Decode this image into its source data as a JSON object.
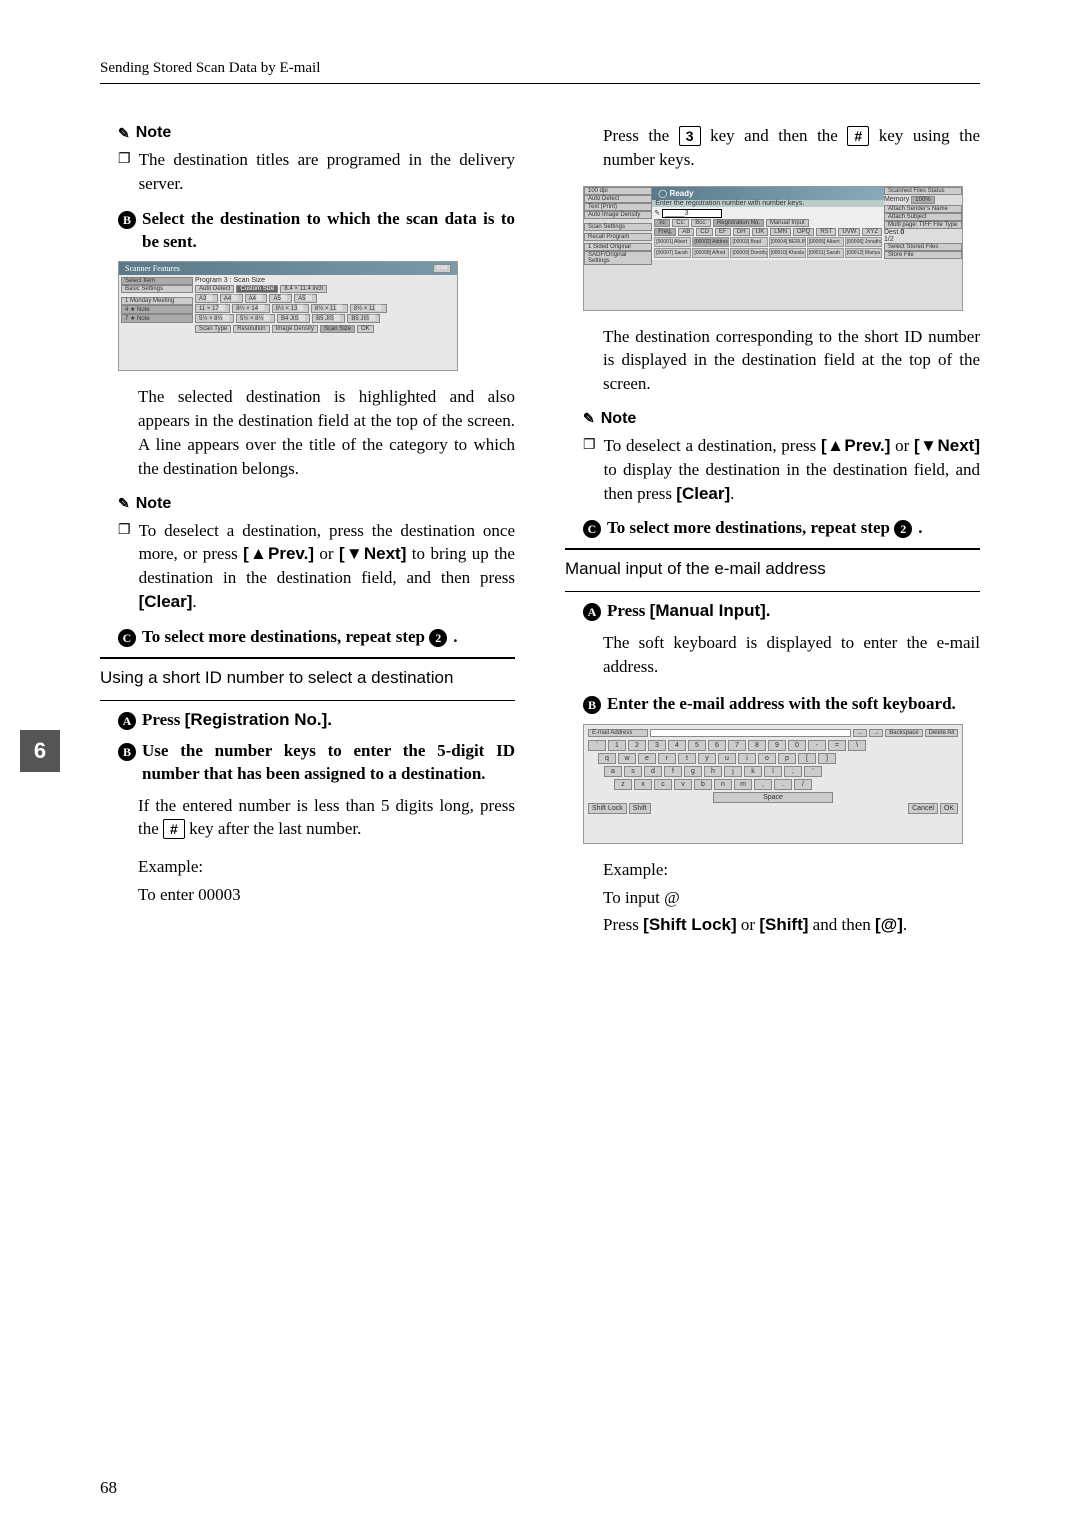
{
  "header": {
    "section_title": "Sending Stored Scan Data by E-mail"
  },
  "page_number": "68",
  "side_tab": "6",
  "left": {
    "note1": {
      "label": "Note",
      "bullet": "The destination titles are programed in the delivery server."
    },
    "step2": "Select the destination to which the scan data is to be sent.",
    "body1": "The selected destination is highlighted and also appears in the destination field at the top of the screen. A line appears over the title of the category to which the destination belongs.",
    "note2": {
      "label": "Note",
      "bullet_pre": "To deselect a destination, press the destination once more, or press ",
      "prev": "[▲Prev.]",
      "mid": " or ",
      "next": "[▼Next]",
      "bullet_post": " to bring up the destination in the destination field, and then press ",
      "clear": "[Clear]",
      "end": "."
    },
    "step3": {
      "pre": "To select more destinations, repeat step ",
      "refnum": "2",
      "post": "."
    },
    "subhead1": "Using a short ID number to select a destination",
    "stepA1": {
      "pre": "Press ",
      "btn": "[Registration No.].",
      "post": ""
    },
    "stepA2": {
      "line": "Use the number keys to enter the 5-digit ID number that has been assigned to a destination.",
      "body_pre": "If the entered number is less than 5 digits long, press the ",
      "key": "#",
      "body_post": " key after the last number."
    },
    "example": "Example:",
    "example_line": "To enter 00003"
  },
  "right": {
    "intro": {
      "pre": "Press the ",
      "key3": "3",
      "mid": " key and then the ",
      "keyhash": "#",
      "post": " key using the number keys."
    },
    "body1": "The destination corresponding to the short ID number is displayed in the destination field at the top of the screen.",
    "note": {
      "label": "Note",
      "bullet_pre": "To deselect a destination, press ",
      "prev": "[▲Prev.]",
      "mid": " or ",
      "next": "[▼Next]",
      "bullet_post": " to display the destination in the destination field, and then press ",
      "clear": "[Clear]",
      "end": "."
    },
    "step3": {
      "pre": "To select more destinations, repeat step ",
      "refnum": "2",
      "post": "."
    },
    "subhead": "Manual input of the e-mail address",
    "mstep1": {
      "pre": "Press ",
      "btn": "[Manual Input].",
      "post": ""
    },
    "mbody1": "The soft keyboard is displayed to enter the e-mail address.",
    "mstep2": "Enter the e-mail address with the soft keyboard.",
    "example": "Example:",
    "example_line": "To input @",
    "example2_pre": "Press ",
    "example2_a": "[Shift Lock]",
    "example2_mid": " or ",
    "example2_b": "[Shift]",
    "example2_mid2": " and then ",
    "example2_c": "[@]",
    "example2_end": "."
  },
  "screenshot1": {
    "title": "Scanner Features",
    "exit": "Exit",
    "tabs": [
      "Select Item",
      "Basic Settings"
    ],
    "subtitle": "Program 3 : Scan Size",
    "auto_detect": "Auto Detect",
    "custom_size": "Custom Size",
    "custom_val": "8.4 × 11.4 inch",
    "sizes_row1": [
      "A3⬜",
      "A4⬜",
      "A4⬜",
      "A5⬜",
      "A5⬜"
    ],
    "sizes_row2": [
      "11 × 17⬜",
      "8½ × 14⬜",
      "8½ × 13⬜",
      "8½ × 11⬜",
      "8½ × 11⬜"
    ],
    "sizes_row3": [
      "5½ × 8½⬜",
      "5½ × 8½⬜",
      "B4 JIS⬜",
      "B5 JIS⬜",
      "B5 JIS⬜"
    ],
    "left_items": [
      "1  Monday Meeting",
      "4  ★ Note",
      "7  ★ Note"
    ],
    "bottom": [
      "Scan Type",
      "Resolution",
      "Image Density",
      "Scan Size"
    ],
    "ok": "OK"
  },
  "screenshot2": {
    "status": "Ready",
    "status_sub": "Enter the registration number with number keys.",
    "scanned_header": "Scanned Files Status",
    "memory": "Memory",
    "mem_val": "100%",
    "left_items": [
      "100 dpi",
      "Auto Detect",
      "Text (Print)",
      "Auto Image Density"
    ],
    "input_prefix": "_____3",
    "tobox": "To:",
    "ccbox": "Cc:",
    "bcc": "Bcc:",
    "regno": "Registration No.",
    "manual": "Manual Input",
    "dest": "Dest.",
    "dest_count": "0",
    "scan_settings": "Scan Settings",
    "tabs": [
      "Freq.",
      "AB",
      "CD",
      "EF",
      "GH",
      "IJK",
      "LMN",
      "OPQ",
      "RST",
      "UVW",
      "XYZ"
    ],
    "recall": "Recall Program",
    "one_sided": "1 Sided Original",
    "sado": "SADF/Original Settings",
    "names": [
      "[00001]\nAlbert",
      "[00002]\nAddress Book Group 1",
      "[00003]\nBrad",
      "[00004]\nBERLIN OF",
      "[00005]\nAlbert",
      "[00006]\nJonathan",
      "[00007]\nSarah",
      "[00008]\nAlfred",
      "[00009]\nDorothy",
      "[00010]\nKhosla",
      "[00011]\nSarah",
      "[00012]\nMariya"
    ],
    "right_buttons": [
      "Attach Sender's Name",
      "Attach Subject",
      "Multi page: TIFF\nFile Type",
      "Select Stored Files",
      "Store File"
    ],
    "paging": "1/2"
  },
  "screenshot3": {
    "title": "E-mail Address",
    "nav": [
      "←",
      "→",
      "Backspace",
      "Delete All"
    ],
    "row1": [
      "`",
      "1",
      "2",
      "3",
      "4",
      "5",
      "6",
      "7",
      "8",
      "9",
      "0",
      "-",
      "=",
      "\\"
    ],
    "row2": [
      "q",
      "w",
      "e",
      "r",
      "t",
      "y",
      "u",
      "i",
      "o",
      "p",
      "[",
      "]"
    ],
    "row3": [
      "a",
      "s",
      "d",
      "f",
      "g",
      "h",
      "j",
      "k",
      "l",
      ";",
      "'"
    ],
    "row4": [
      "z",
      "x",
      "c",
      "v",
      "b",
      "n",
      "m",
      ",",
      ".",
      "/"
    ],
    "space": "Space",
    "shift_lock": "Shift Lock",
    "shift": "Shift",
    "cancel": "Cancel",
    "ok": "OK"
  }
}
